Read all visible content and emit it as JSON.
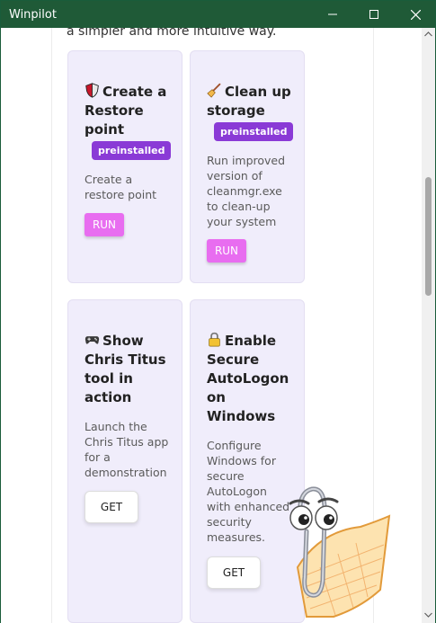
{
  "window": {
    "title": "Winpilot"
  },
  "intro_text": "a simpler and more intuitive way.",
  "cards": [
    {
      "icon": "shield-icon",
      "title": "Create a Restore point",
      "badge": "preinstalled",
      "description": "Create a restore point",
      "button": "RUN"
    },
    {
      "icon": "broom-icon",
      "title": "Clean up storage",
      "badge": "preinstalled",
      "description": "Run improved version of cleanmgr.exe to clean-up your system",
      "button": "RUN"
    },
    {
      "icon": "gamepad-icon",
      "title": "Show Chris Titus tool in action",
      "description": "Launch the Chris Titus app for a demonstration",
      "button": "GET"
    },
    {
      "icon": "lock-icon",
      "title": "Enable Secure AutoLogon on Windows",
      "description": "Configure Windows for secure AutoLogon with enhanced security measures.",
      "button": "GET"
    }
  ],
  "colors": {
    "titlebar": "#1f5a37",
    "card_bg": "#f0edfb",
    "badge": "#8a3ad6",
    "run_button": "#e86df0"
  }
}
